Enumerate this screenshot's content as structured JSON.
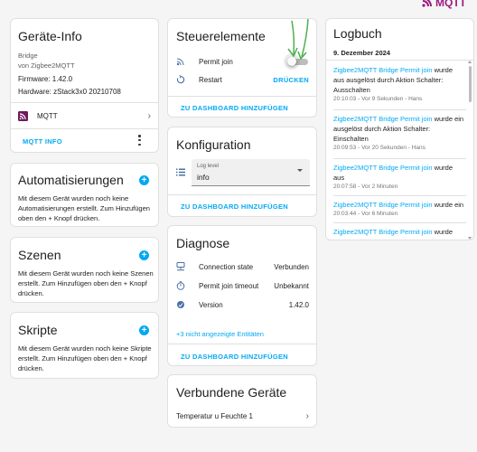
{
  "brand": {
    "logo_text": "MQTT",
    "logo_color": "#9c1a80"
  },
  "device_info": {
    "title": "Geräte-Info",
    "model": "Bridge",
    "manufacturer": "von Zigbee2MQTT",
    "firmware": "Firmware: 1.42.0",
    "hardware": "Hardware: zStack3x0 20210708",
    "integration_label": "MQTT",
    "action_label": "MQTT INFO"
  },
  "automations": {
    "title": "Automatisierungen",
    "text": "Mit diesem Gerät wurden noch keine Automatisierungen erstellt. Zum Hinzufügen oben den + Knopf drücken."
  },
  "scenes": {
    "title": "Szenen",
    "text": "Mit diesem Gerät wurden noch keine Szenen erstellt. Zum Hinzufügen oben den + Knopf drücken."
  },
  "scripts": {
    "title": "Skripte",
    "text": "Mit diesem Gerät wurden noch keine Skripte erstellt. Zum Hinzufügen oben den + Knopf drücken."
  },
  "controls": {
    "title": "Steuerelemente",
    "permit_join_label": "Permit join",
    "permit_join_on": false,
    "restart_label": "Restart",
    "restart_action": "DRÜCKEN",
    "add_to_dashboard": "ZU DASHBOARD HINZUFÜGEN"
  },
  "configuration": {
    "title": "Konfiguration",
    "log_level_label": "Log level",
    "log_level_value": "info",
    "add_to_dashboard": "ZU DASHBOARD HINZUFÜGEN"
  },
  "diagnostics": {
    "title": "Diagnose",
    "rows": [
      {
        "label": "Connection state",
        "value": "Verbunden"
      },
      {
        "label": "Permit join timeout",
        "value": "Unbekannt"
      },
      {
        "label": "Version",
        "value": "1.42.0"
      }
    ],
    "hidden_entities": "+3 nicht angezeigte Entitäten",
    "add_to_dashboard": "ZU DASHBOARD HINZUFÜGEN"
  },
  "connected_devices": {
    "title": "Verbundene Geräte",
    "items": [
      "Temperatur u Feuchte 1"
    ]
  },
  "logbook": {
    "title": "Logbuch",
    "date": "9. Dezember 2024",
    "entries": [
      {
        "entity": "Zigbee2MQTT Bridge Permit join",
        "text1": " wurde",
        "text2": "aus ausgelöst durch Aktion Schalter:",
        "text3": "Ausschalten",
        "time": "20:10:03 - Vor 9 Sekunden - Hans"
      },
      {
        "entity": "Zigbee2MQTT Bridge Permit join",
        "text1": " wurde ein",
        "text2": "ausgelöst durch Aktion Schalter:",
        "text3": "Einschalten",
        "time": "20:09:53 - Vor 20 Sekunden - Hans"
      },
      {
        "entity": "Zigbee2MQTT Bridge Permit join",
        "text1": " wurde",
        "text2": "aus",
        "text3": "",
        "time": "20:07:58 - Vor 2 Minuten"
      },
      {
        "entity": "Zigbee2MQTT Bridge Permit join",
        "text1": " wurde ein",
        "text2": "",
        "text3": "",
        "time": "20:03:44 - Vor 6 Minuten"
      },
      {
        "entity": "Zigbee2MQTT Bridge Permit join",
        "text1": " wurde",
        "text2": "",
        "text3": "",
        "time": ""
      }
    ]
  },
  "annotation": {
    "arrow_color": "#4caf50"
  }
}
